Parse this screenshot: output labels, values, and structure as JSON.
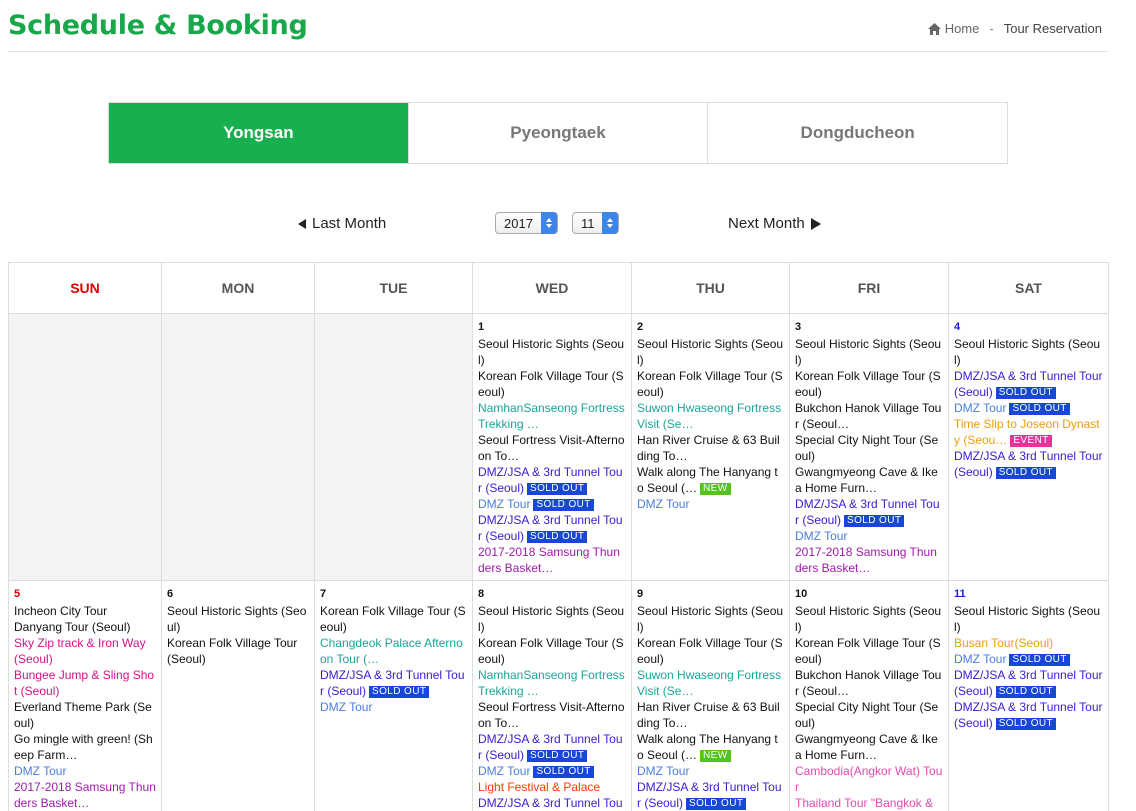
{
  "page": {
    "title": "Schedule & Booking"
  },
  "breadcrumb": {
    "home": "Home",
    "separator": "-",
    "current": "Tour Reservation"
  },
  "tabs": [
    {
      "label": "Yongsan",
      "active": true
    },
    {
      "label": "Pyeongtaek",
      "active": false
    },
    {
      "label": "Dongducheon",
      "active": false
    }
  ],
  "month_nav": {
    "prev_label": "Last Month",
    "next_label": "Next Month",
    "year": "2017",
    "month": "11"
  },
  "weekdays": [
    "SUN",
    "MON",
    "TUE",
    "WED",
    "THU",
    "FRI",
    "SAT"
  ],
  "colors": {
    "accent": "#18b04e",
    "sunday": "#e00000",
    "saturday": "#1a1ae0",
    "black": "#111111",
    "teal": "#1aa59a",
    "blue": "#3a1ad6",
    "lightblue": "#4a7ee0",
    "purple": "#a21ab0",
    "magenta": "#d1138a",
    "orange": "#ef9d0e",
    "pink": "#e24ab0",
    "red": "#ff3b00",
    "soldout": "#1846d6",
    "new": "#52c41a",
    "event": "#e8329a"
  },
  "weeks": [
    [
      {
        "empty": true
      },
      {
        "empty": true
      },
      {
        "empty": true
      },
      {
        "day": "1",
        "events": [
          {
            "text": "Seoul Historic Sights (Seoul)",
            "color": "black"
          },
          {
            "text": "Korean Folk Village Tour (Seoul)",
            "color": "black"
          },
          {
            "text": "NamhanSanseong Fortress Trekking …",
            "color": "teal"
          },
          {
            "text": "Seoul Fortress Visit-Afternoon To…",
            "color": "black"
          },
          {
            "text": "DMZ/JSA & 3rd Tunnel Tour (Seoul)",
            "color": "blue",
            "badge": "SOLD OUT",
            "badge_type": "soldout"
          },
          {
            "text": "DMZ Tour",
            "color": "lightblue",
            "badge": "SOLD OUT",
            "badge_type": "soldout"
          },
          {
            "text": "DMZ/JSA & 3rd Tunnel Tour (Seoul)",
            "color": "blue",
            "badge": "SOLD OUT",
            "badge_type": "soldout"
          },
          {
            "text": "2017-2018 Samsung Thunders Basket…",
            "color": "purple"
          }
        ]
      },
      {
        "day": "2",
        "events": [
          {
            "text": "Seoul Historic Sights (Seoul)",
            "color": "black"
          },
          {
            "text": "Korean Folk Village Tour (Seoul)",
            "color": "black"
          },
          {
            "text": "Suwon Hwaseong Fortress Visit (Se…",
            "color": "teal"
          },
          {
            "text": "Han River Cruise & 63 Building To…",
            "color": "black"
          },
          {
            "text": "Walk along The Hanyang to Seoul (…",
            "color": "black",
            "badge": "NEW",
            "badge_type": "new"
          },
          {
            "text": "DMZ Tour",
            "color": "lightblue"
          }
        ]
      },
      {
        "day": "3",
        "events": [
          {
            "text": "Seoul Historic Sights (Seoul)",
            "color": "black"
          },
          {
            "text": "Korean Folk Village Tour (Seoul)",
            "color": "black"
          },
          {
            "text": "Bukchon Hanok Village Tour (Seoul…",
            "color": "black"
          },
          {
            "text": "Special City Night Tour (Seoul)",
            "color": "black"
          },
          {
            "text": "Gwangmyeong Cave & Ikea Home Furn…",
            "color": "black"
          },
          {
            "text": "DMZ/JSA & 3rd Tunnel Tour (Seoul)",
            "color": "blue",
            "badge": "SOLD OUT",
            "badge_type": "soldout"
          },
          {
            "text": "DMZ Tour",
            "color": "lightblue"
          },
          {
            "text": "2017-2018 Samsung Thunders Basket…",
            "color": "purple"
          }
        ]
      },
      {
        "day": "4",
        "dayclass": "sat",
        "events": [
          {
            "text": "Seoul Historic Sights (Seoul)",
            "color": "black"
          },
          {
            "text": "DMZ/JSA & 3rd Tunnel Tour (Seoul)",
            "color": "blue",
            "badge": "SOLD OUT",
            "badge_type": "soldout"
          },
          {
            "text": "DMZ Tour",
            "color": "lightblue",
            "badge": "SOLD OUT",
            "badge_type": "soldout"
          },
          {
            "text": "Time Slip to Joseon Dynasty (Seou…",
            "color": "orange",
            "badge": "EVENT",
            "badge_type": "event"
          },
          {
            "text": "DMZ/JSA & 3rd Tunnel Tour (Seoul)",
            "color": "blue",
            "badge": "SOLD OUT",
            "badge_type": "soldout"
          }
        ]
      }
    ],
    [
      {
        "day": "5",
        "dayclass": "sun",
        "events": [
          {
            "text": "Incheon City Tour",
            "color": "black"
          },
          {
            "text": "Danyang Tour (Seoul)",
            "color": "black"
          },
          {
            "text": "Sky Zip track & Iron Way (Seoul)",
            "color": "magenta"
          },
          {
            "text": "Bungee Jump & Sling Shot (Seoul)",
            "color": "magenta"
          },
          {
            "text": "Everland Theme Park (Seoul)",
            "color": "black"
          },
          {
            "text": "Go mingle with green! (Sheep Farm…",
            "color": "black"
          },
          {
            "text": "DMZ Tour",
            "color": "lightblue"
          },
          {
            "text": "2017-2018 Samsung Thunders Basket…",
            "color": "purple"
          }
        ]
      },
      {
        "day": "6",
        "events": [
          {
            "text": "Seoul Historic Sights (Seoul)",
            "color": "black"
          },
          {
            "text": "Korean Folk Village Tour (Seoul)",
            "color": "black"
          }
        ]
      },
      {
        "day": "7",
        "events": [
          {
            "text": "Korean Folk Village Tour (Seoul)",
            "color": "black"
          },
          {
            "text": "Changdeok Palace Afternoon Tour (…",
            "color": "teal"
          },
          {
            "text": "DMZ/JSA & 3rd Tunnel Tour (Seoul)",
            "color": "blue",
            "badge": "SOLD OUT",
            "badge_type": "soldout"
          },
          {
            "text": "DMZ Tour",
            "color": "lightblue"
          }
        ]
      },
      {
        "day": "8",
        "events": [
          {
            "text": "Seoul Historic Sights (Seoul)",
            "color": "black"
          },
          {
            "text": "Korean Folk Village Tour (Seoul)",
            "color": "black"
          },
          {
            "text": "NamhanSanseong Fortress Trekking …",
            "color": "teal"
          },
          {
            "text": "Seoul Fortress Visit-Afternoon To…",
            "color": "black"
          },
          {
            "text": "DMZ/JSA & 3rd Tunnel Tour (Seoul)",
            "color": "blue",
            "badge": "SOLD OUT",
            "badge_type": "soldout"
          },
          {
            "text": "DMZ Tour",
            "color": "lightblue",
            "badge": "SOLD OUT",
            "badge_type": "soldout"
          },
          {
            "text": "Light Festival & Palace",
            "color": "red"
          },
          {
            "text": "DMZ/JSA & 3rd Tunnel Tou",
            "color": "blue"
          }
        ]
      },
      {
        "day": "9",
        "events": [
          {
            "text": "Seoul Historic Sights (Seoul)",
            "color": "black"
          },
          {
            "text": "Korean Folk Village Tour (Seoul)",
            "color": "black"
          },
          {
            "text": "Suwon Hwaseong Fortress Visit (Se…",
            "color": "teal"
          },
          {
            "text": "Han River Cruise & 63 Building To…",
            "color": "black"
          },
          {
            "text": "Walk along The Hanyang to Seoul (…",
            "color": "black",
            "badge": "NEW",
            "badge_type": "new"
          },
          {
            "text": "DMZ Tour",
            "color": "lightblue"
          },
          {
            "text": "DMZ/JSA & 3rd Tunnel Tour (Seoul)",
            "color": "blue",
            "badge": "SOLD OUT",
            "badge_type": "soldout"
          }
        ]
      },
      {
        "day": "10",
        "events": [
          {
            "text": "Seoul Historic Sights (Seoul)",
            "color": "black"
          },
          {
            "text": "Korean Folk Village Tour (Seoul)",
            "color": "black"
          },
          {
            "text": "Bukchon Hanok Village Tour (Seoul…",
            "color": "black"
          },
          {
            "text": "Special City Night Tour (Seoul)",
            "color": "black"
          },
          {
            "text": "Gwangmyeong Cave & Ikea Home Furn…",
            "color": "black"
          },
          {
            "text": "Cambodia(Angkor Wat) Tour",
            "color": "pink"
          },
          {
            "text": "Thailand Tour \"Bangkok &",
            "color": "pink"
          }
        ]
      },
      {
        "day": "11",
        "dayclass": "sat",
        "events": [
          {
            "text": "Seoul Historic Sights (Seoul)",
            "color": "black"
          },
          {
            "text": "Busan Tour(Seoul)",
            "color": "orange"
          },
          {
            "text": "DMZ Tour",
            "color": "lightblue",
            "badge": "SOLD OUT",
            "badge_type": "soldout"
          },
          {
            "text": "DMZ/JSA & 3rd Tunnel Tour (Seoul)",
            "color": "blue",
            "badge": "SOLD OUT",
            "badge_type": "soldout"
          },
          {
            "text": "DMZ/JSA & 3rd Tunnel Tour (Seoul)",
            "color": "blue",
            "badge": "SOLD OUT",
            "badge_type": "soldout"
          }
        ]
      }
    ]
  ]
}
